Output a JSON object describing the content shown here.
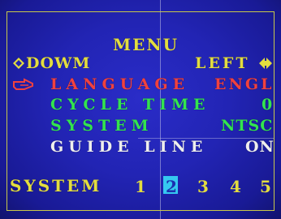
{
  "menu": {
    "title": "MENU",
    "nav_left": "DOWM",
    "nav_right": "LEFT",
    "items": [
      {
        "label": "LANGUAGE",
        "value": "ENGL"
      },
      {
        "label": "CYCLE TIME",
        "value": "0"
      },
      {
        "label": "SYSTEM",
        "value": "NTSC"
      },
      {
        "label": "GUIDE LINE",
        "value": "ON"
      }
    ]
  },
  "system_select": {
    "label": "SYSTEM",
    "options": [
      "1",
      "2",
      "3",
      "4",
      "5"
    ],
    "selected": "2"
  },
  "colors": {
    "background": "#2224b4",
    "title": "#e3dd3f",
    "selected_item": "#f0413f",
    "normal_item": "#33e44f",
    "guide_line_item": "#eeeeee",
    "highlight": "#35c8f0"
  },
  "icons": {
    "up_down_arrow": "up-down-arrow-icon",
    "pointer_hand": "pointing-hand-icon",
    "left_right_arrow": "left-right-arrow-icon"
  }
}
